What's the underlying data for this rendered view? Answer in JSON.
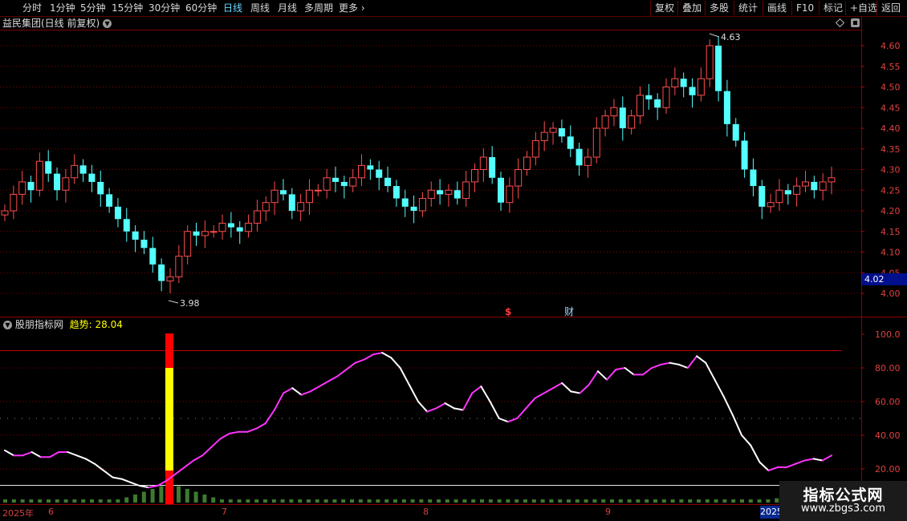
{
  "toolbar": {
    "periods": [
      "分时",
      "1分钟",
      "5分钟",
      "15分钟",
      "30分钟",
      "60分钟",
      "日线",
      "周线",
      "月线",
      "多周期"
    ],
    "more_label": "更多",
    "more_icon": "chevron-right-icon",
    "active_period": "日线",
    "right_buttons": [
      "复权",
      "叠加",
      "多股",
      "统计",
      "画线",
      "F10",
      "标记",
      "+自选",
      "返回"
    ]
  },
  "main_chart": {
    "title": "益民集团(日线 前复权)",
    "dropdown_icon": "chevron-down-icon",
    "right_icons": [
      "diamond-icon",
      "panel-toggle-icon"
    ],
    "price_ticks": [
      "4.60",
      "4.55",
      "4.50",
      "4.45",
      "4.40",
      "4.35",
      "4.30",
      "4.25",
      "4.20",
      "4.15",
      "4.10",
      "4.05",
      "4.00"
    ],
    "high_label": "4.63",
    "low_label": "3.98",
    "current_price": "4.02",
    "event_markers": [
      "$",
      "财"
    ]
  },
  "indicator": {
    "name": "股朋指标网",
    "series_label": "趋势:",
    "series_value": "28.04",
    "y_ticks": [
      "100.0",
      "80.00",
      "60.00",
      "40.00",
      "20.00"
    ]
  },
  "time_axis": {
    "start_label": "2025年",
    "months": [
      "6",
      "7",
      "8",
      "9"
    ],
    "end_label": "2025"
  },
  "watermark": {
    "title": "指标公式网",
    "url": "www.zbgs3.com"
  },
  "chart_data": {
    "type": "candlestick",
    "ylim": [
      3.98,
      4.63
    ],
    "indicator_ylim": [
      0,
      100
    ],
    "indicator_series": {
      "name": "趋势",
      "values": [
        31,
        28,
        28,
        30,
        27,
        27,
        30,
        30,
        28,
        26,
        23,
        19,
        15,
        14,
        12,
        10,
        9,
        10,
        13,
        17,
        21,
        25,
        28,
        33,
        38,
        41,
        42,
        42,
        44,
        47,
        55,
        65,
        68,
        64,
        66,
        69,
        72,
        75,
        79,
        83,
        85,
        88,
        89,
        86,
        80,
        70,
        60,
        54,
        56,
        59,
        56,
        55,
        65,
        69,
        60,
        50,
        48,
        50,
        56,
        62,
        65,
        68,
        71,
        66,
        65,
        70,
        78,
        73,
        79,
        80,
        76,
        76,
        80,
        82,
        83,
        82,
        80,
        87,
        83,
        73,
        63,
        52,
        40,
        34,
        24,
        19,
        21,
        21,
        23,
        25,
        26,
        25,
        28
      ]
    },
    "signal_bar": {
      "index": 19,
      "red_top": 100,
      "yellow_top": 80,
      "yellow_bottom": 19,
      "red_bottom": 0
    }
  }
}
